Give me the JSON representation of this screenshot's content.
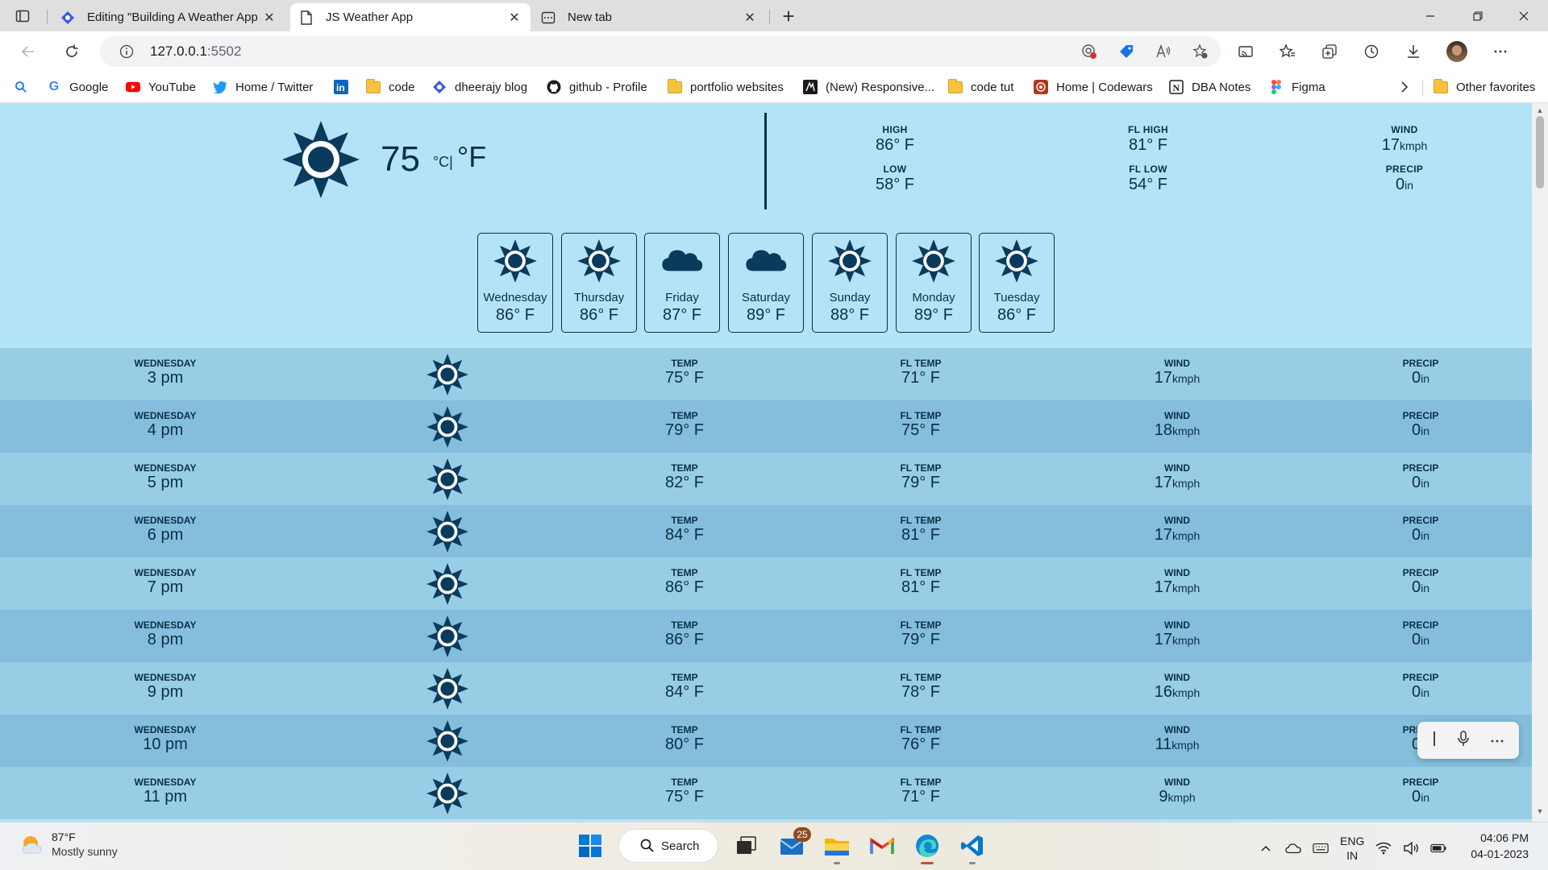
{
  "browser": {
    "tabs": [
      {
        "title": "Editing \"Building A Weather App",
        "close": "✕"
      },
      {
        "title": "JS Weather App",
        "close": "✕"
      },
      {
        "title": "New tab",
        "close": "✕"
      }
    ],
    "new_tab": "+",
    "url_host": "127.0.0.1",
    "url_port": ":5502",
    "bookmarks": [
      {
        "label": "Google"
      },
      {
        "label": "YouTube"
      },
      {
        "label": "Home / Twitter"
      },
      {
        "label": "code"
      },
      {
        "label": "dheerajy blog"
      },
      {
        "label": "github - Profile"
      },
      {
        "label": "portfolio websites"
      },
      {
        "label": "(New) Responsive..."
      },
      {
        "label": "code tut"
      },
      {
        "label": "Home | Codewars"
      },
      {
        "label": "DBA Notes"
      },
      {
        "label": "Figma"
      },
      {
        "label": "Other favorites"
      }
    ]
  },
  "current": {
    "temp": "75",
    "unit_c": "°C|",
    "unit_f": "°F",
    "icon": "sun-icon",
    "high_label": "HIGH",
    "high_value": "86° F",
    "low_label": "LOW",
    "low_value": "58° F",
    "fl_high_label": "FL HIGH",
    "fl_high_value": "81° F",
    "fl_low_label": "FL LOW",
    "fl_low_value": "54° F",
    "wind_label": "WIND",
    "wind_value": "17",
    "wind_unit": "kmph",
    "precip_label": "PRECIP",
    "precip_value": "0",
    "precip_unit": "in"
  },
  "daily": [
    {
      "day": "Wednesday",
      "temp": "86° F",
      "icon": "sun-icon"
    },
    {
      "day": "Thursday",
      "temp": "86° F",
      "icon": "sun-icon"
    },
    {
      "day": "Friday",
      "temp": "87° F",
      "icon": "cloud-icon"
    },
    {
      "day": "Saturday",
      "temp": "89° F",
      "icon": "cloud-icon"
    },
    {
      "day": "Sunday",
      "temp": "88° F",
      "icon": "sun-icon"
    },
    {
      "day": "Monday",
      "temp": "89° F",
      "icon": "sun-icon"
    },
    {
      "day": "Tuesday",
      "temp": "86° F",
      "icon": "sun-icon"
    }
  ],
  "hourly_labels": {
    "temp": "TEMP",
    "fl_temp": "FL TEMP",
    "wind": "WIND",
    "precip": "PRECIP",
    "wind_unit": "kmph",
    "precip_unit": "in"
  },
  "hourly": [
    {
      "day": "WEDNESDAY",
      "time": "3 pm",
      "temp": "75° F",
      "fl_temp": "71° F",
      "wind": "17",
      "precip": "0"
    },
    {
      "day": "WEDNESDAY",
      "time": "4 pm",
      "temp": "79° F",
      "fl_temp": "75° F",
      "wind": "18",
      "precip": "0"
    },
    {
      "day": "WEDNESDAY",
      "time": "5 pm",
      "temp": "82° F",
      "fl_temp": "79° F",
      "wind": "17",
      "precip": "0"
    },
    {
      "day": "WEDNESDAY",
      "time": "6 pm",
      "temp": "84° F",
      "fl_temp": "81° F",
      "wind": "17",
      "precip": "0"
    },
    {
      "day": "WEDNESDAY",
      "time": "7 pm",
      "temp": "86° F",
      "fl_temp": "81° F",
      "wind": "17",
      "precip": "0"
    },
    {
      "day": "WEDNESDAY",
      "time": "8 pm",
      "temp": "86° F",
      "fl_temp": "79° F",
      "wind": "17",
      "precip": "0"
    },
    {
      "day": "WEDNESDAY",
      "time": "9 pm",
      "temp": "84° F",
      "fl_temp": "78° F",
      "wind": "16",
      "precip": "0"
    },
    {
      "day": "WEDNESDAY",
      "time": "10 pm",
      "temp": "80° F",
      "fl_temp": "76° F",
      "wind": "11",
      "precip": "0"
    },
    {
      "day": "WEDNESDAY",
      "time": "11 pm",
      "temp": "75° F",
      "fl_temp": "71° F",
      "wind": "9",
      "precip": "0"
    }
  ],
  "taskbar": {
    "weather_temp": "87°F",
    "weather_desc": "Mostly sunny",
    "search_label": "Search",
    "mail_badge": "25",
    "lang_1": "ENG",
    "lang_2": "IN",
    "time": "04:06 PM",
    "date": "04-01-2023"
  },
  "colors": {
    "page_bg": "#b4e3f7",
    "row_odd": "#98cde6",
    "row_even": "#84bedc",
    "icon": "#0b3b5c"
  }
}
